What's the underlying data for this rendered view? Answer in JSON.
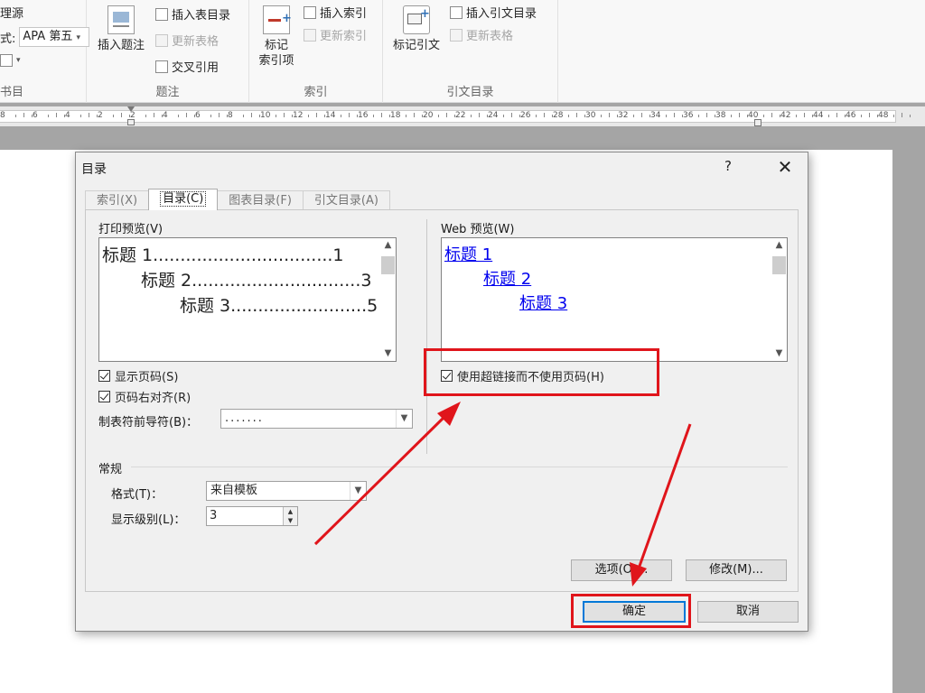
{
  "ribbon": {
    "source_fragment": "理源",
    "style_prefix": "式:",
    "style_value": "APA 第五",
    "groups": {
      "bibliography": {
        "label": "书目"
      },
      "captions": {
        "label": "题注",
        "insert_caption": "插入题注",
        "insert_table_of_figures": "插入表目录",
        "update_table": "更新表格",
        "cross_reference": "交叉引用"
      },
      "index": {
        "label": "索引",
        "mark_entry_line1": "标记",
        "mark_entry_line2": "索引项",
        "insert_index": "插入索引",
        "update_index": "更新索引"
      },
      "toa": {
        "label": "引文目录",
        "mark_citation": "标记引文",
        "insert_toa": "插入引文目录",
        "update_table": "更新表格"
      }
    }
  },
  "ruler": {
    "labels": [
      "8",
      "6",
      "4",
      "2",
      "2",
      "4",
      "6",
      "8",
      "10",
      "12",
      "14",
      "16",
      "18",
      "20",
      "22",
      "24",
      "26",
      "28",
      "30",
      "32",
      "34",
      "36",
      "38",
      "40",
      "42",
      "44",
      "46",
      "48"
    ]
  },
  "dialog": {
    "title": "目录",
    "help": "?",
    "close": "✕",
    "tabs": [
      "索引(X)",
      "目录(C)",
      "图表目录(F)",
      "引文目录(A)"
    ],
    "print_preview": {
      "label": "打印预览(V)",
      "lines": [
        "标题 1.................................1",
        "标题 2...............................3",
        "标题 3.........................5"
      ]
    },
    "web_preview": {
      "label": "Web 预览(W)",
      "lines": [
        "标题 1",
        "标题 2",
        "标题 3"
      ]
    },
    "show_page_numbers": "显示页码(S)",
    "right_align_page_numbers": "页码右对齐(R)",
    "use_hyperlinks": "使用超链接而不使用页码(H)",
    "tab_leader": {
      "label": "制表符前导符(B)：",
      "value": "......."
    },
    "general": {
      "label": "常规",
      "formats": {
        "label": "格式(T)：",
        "value": "来自模板"
      },
      "levels": {
        "label": "显示级别(L)：",
        "value": "3"
      }
    },
    "options_button": "选项(O)...",
    "modify_button": "修改(M)...",
    "ok_button": "确定",
    "cancel_button": "取消"
  },
  "colors": {
    "highlight": "#e0151b",
    "hyperlink": "#0000ee"
  }
}
